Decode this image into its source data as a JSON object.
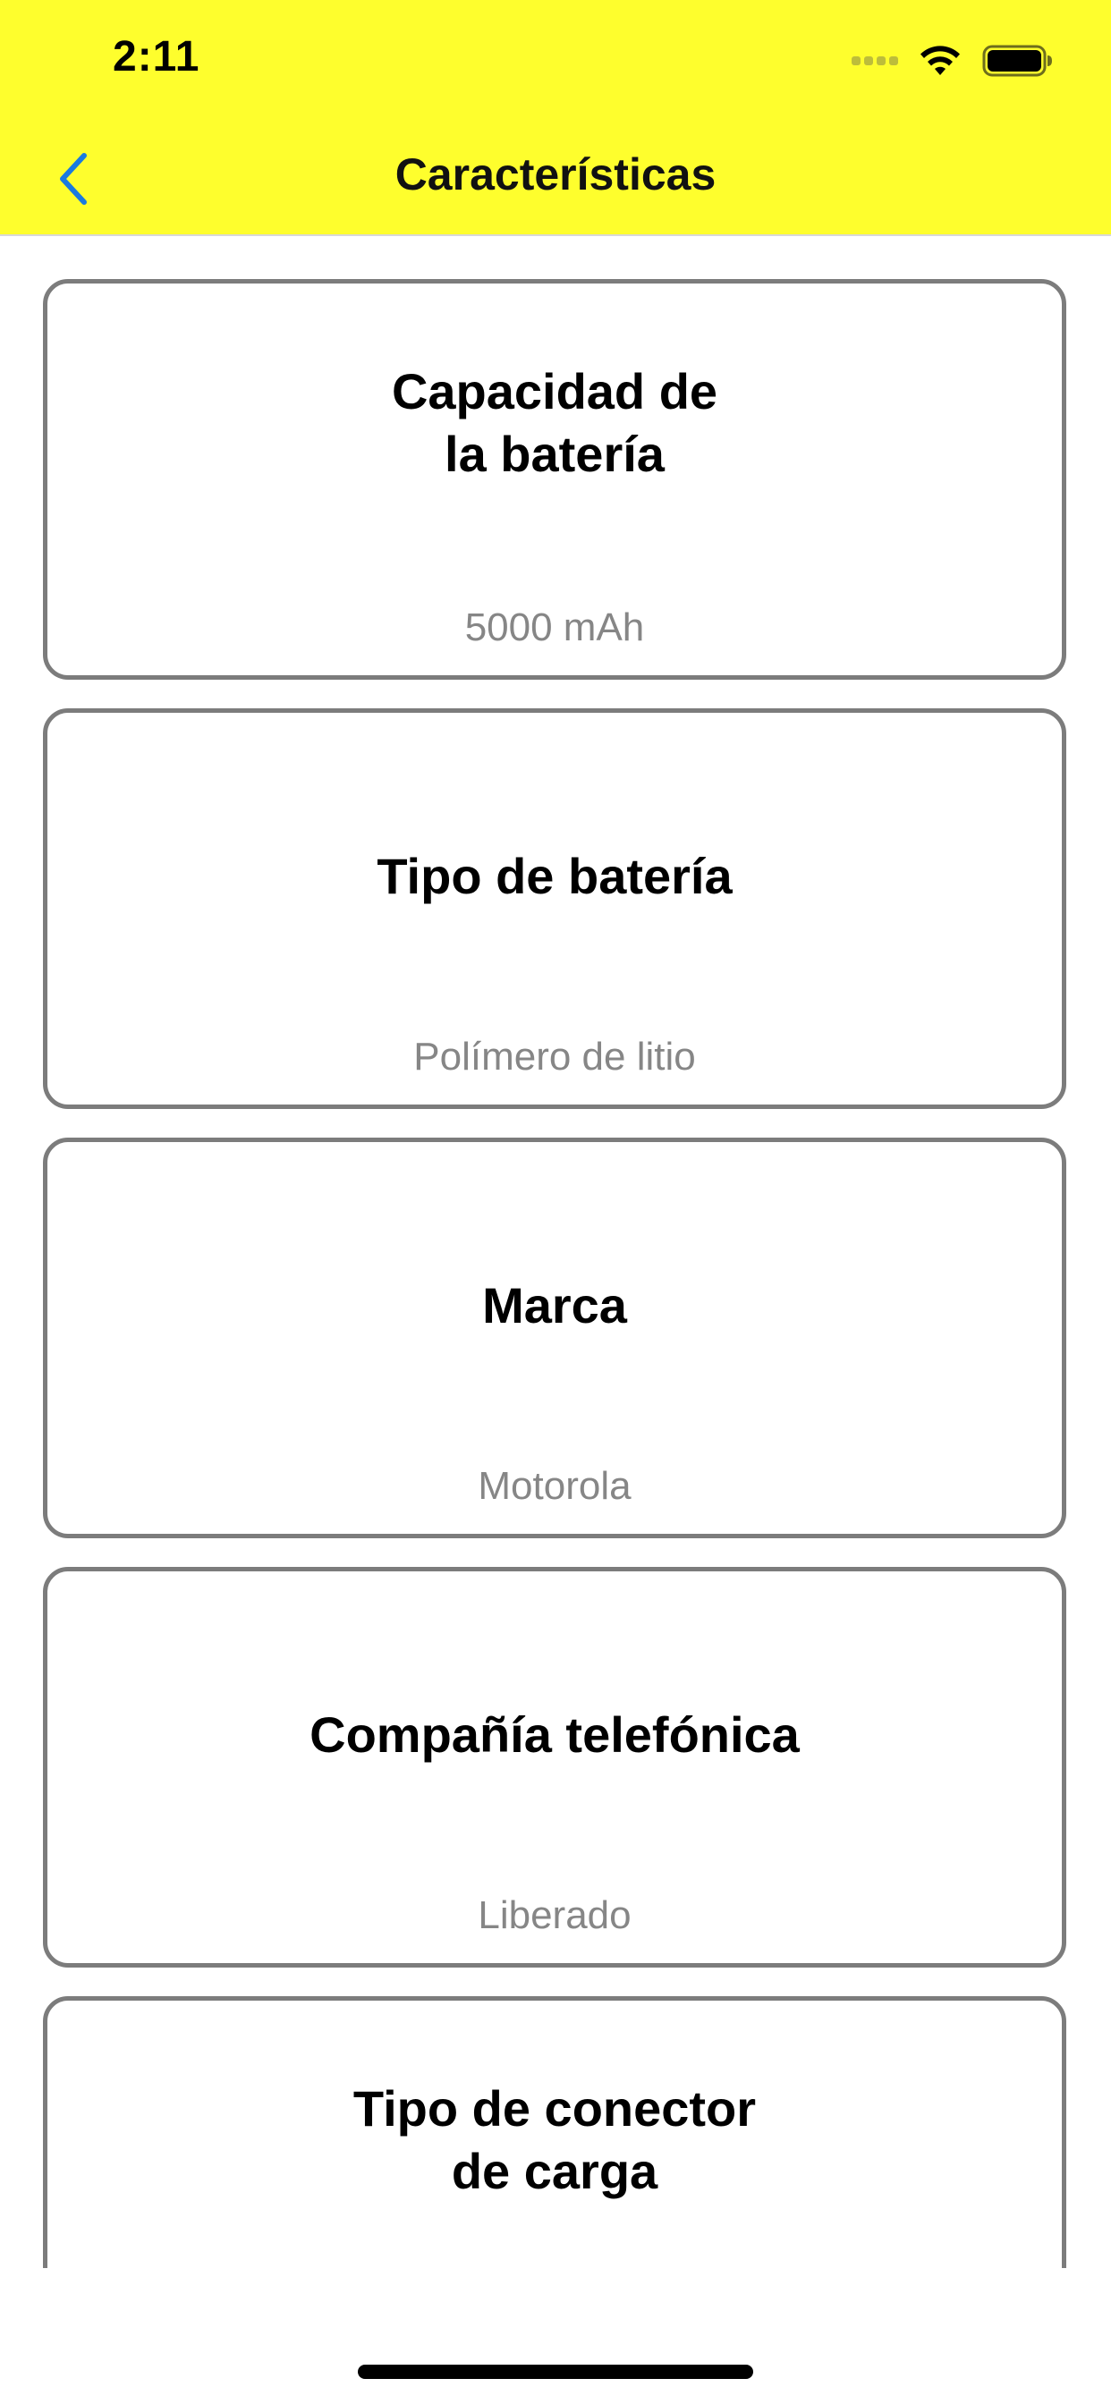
{
  "status_bar": {
    "time": "2:11",
    "icons": [
      "signal-dots-icon",
      "wifi-icon",
      "battery-icon"
    ]
  },
  "nav": {
    "back_icon": "chevron-left-icon",
    "title": "Características"
  },
  "colors": {
    "nav_background": "#fefe2d",
    "back_icon": "#1a7ae0",
    "card_border": "#7c7c7c",
    "value_text": "#868686"
  },
  "cards": [
    {
      "title": "Capacidad de\nla batería",
      "value": "5000 mAh"
    },
    {
      "title": "Tipo de batería",
      "value": "Polímero de litio"
    },
    {
      "title": "Marca",
      "value": "Motorola"
    },
    {
      "title": "Compañía telefónica",
      "value": "Liberado"
    },
    {
      "title": "Tipo de conector\nde carga",
      "value": ""
    }
  ]
}
